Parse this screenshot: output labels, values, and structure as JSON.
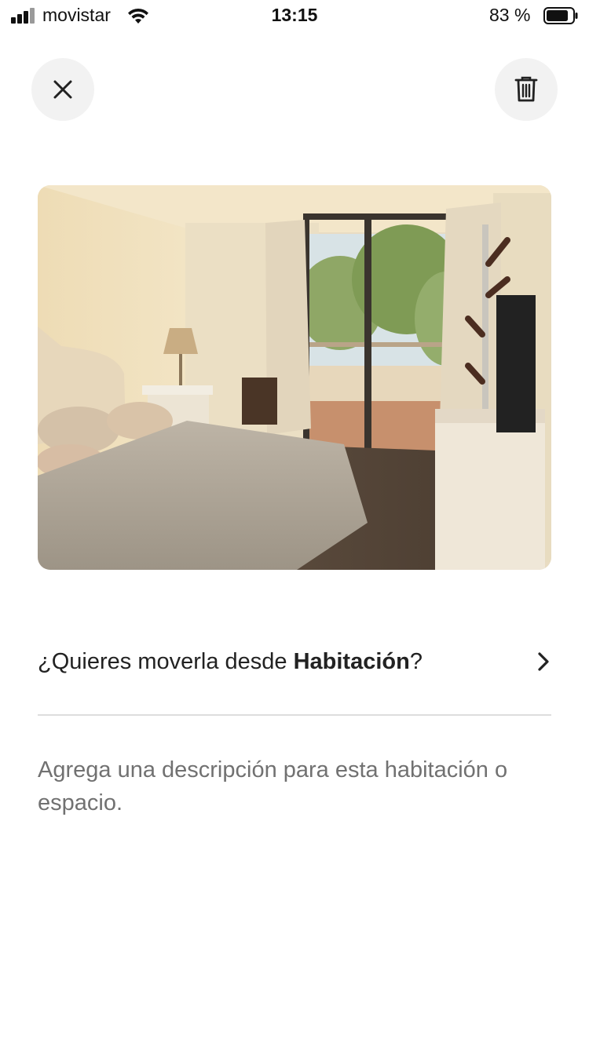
{
  "status_bar": {
    "carrier": "movistar",
    "time": "13:15",
    "battery_percent": "83 %",
    "battery_level": 0.83
  },
  "toolbar": {
    "close_icon": "close-icon",
    "delete_icon": "trash-icon"
  },
  "photo": {
    "subject": "bedroom-photo"
  },
  "move": {
    "prefix": "¿Quieres moverla desde ",
    "room": "Habitación",
    "suffix": "?",
    "chevron_icon": "chevron-right-icon"
  },
  "description": {
    "placeholder": "Agrega una descripción para esta habitación o espacio."
  },
  "colors": {
    "text": "#222222",
    "muted": "#717171",
    "button_bg": "#f2f2f2",
    "divider": "#dddddd"
  }
}
